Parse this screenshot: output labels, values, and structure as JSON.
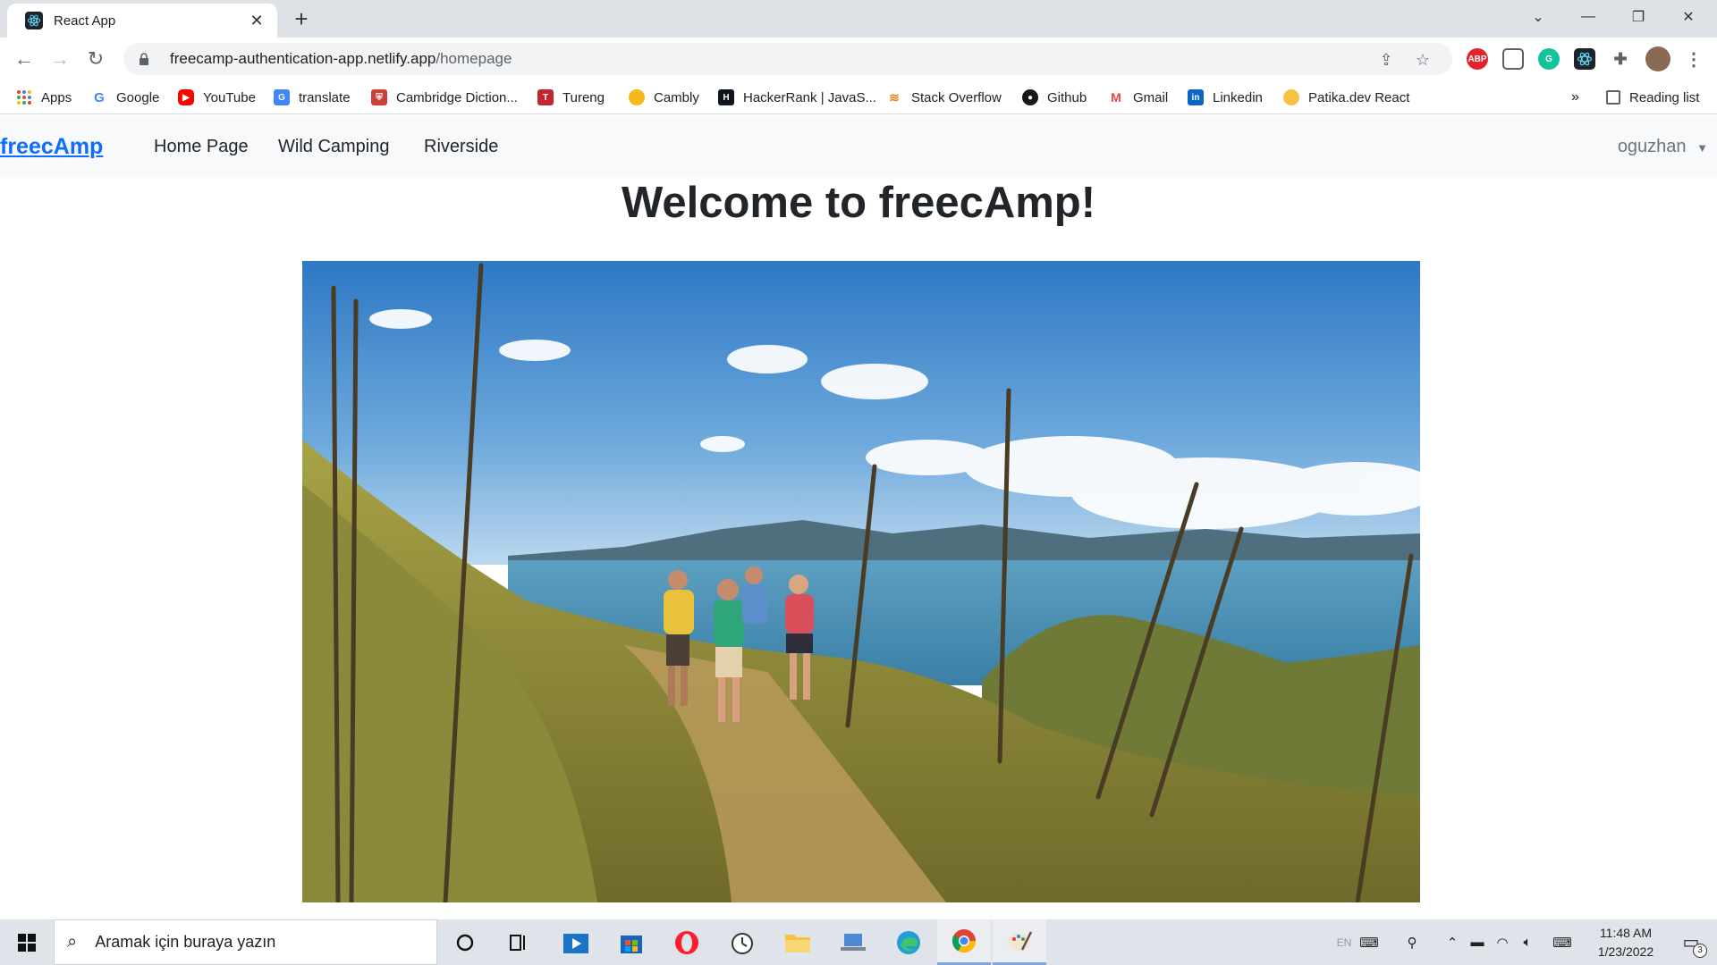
{
  "browser": {
    "tab": {
      "title": "React App"
    },
    "address": {
      "host": "freecamp-authentication-app.netlify.app",
      "path": "/homepage"
    },
    "bookmarks": [
      {
        "label": "Apps"
      },
      {
        "label": "Google"
      },
      {
        "label": "YouTube"
      },
      {
        "label": "translate"
      },
      {
        "label": "Cambridge Diction..."
      },
      {
        "label": "Tureng"
      },
      {
        "label": "Cambly"
      },
      {
        "label": "HackerRank | JavaS..."
      },
      {
        "label": "Stack Overflow"
      },
      {
        "label": "Github"
      },
      {
        "label": "Gmail"
      },
      {
        "label": "Linkedin"
      },
      {
        "label": "Patika.dev React"
      }
    ],
    "more_bookmarks": "»",
    "reading_list": "Reading list",
    "extension_labels": {
      "abp": "ABP"
    }
  },
  "page": {
    "navbar": {
      "brand": "freecAmp",
      "links": [
        "Home Page",
        "Wild Camping",
        "Riverside"
      ],
      "user": "oguzhan"
    },
    "title": "Welcome to freecAmp!"
  },
  "taskbar": {
    "search_placeholder": "Aramak için buraya yazın",
    "language": "EN",
    "time": "11:48 AM",
    "date": "1/23/2022",
    "notification_count": "3"
  },
  "colors": {
    "brand_link": "#0d6efd",
    "navbar_bg": "#f8f9fa",
    "tabstrip_bg": "#dee1e6",
    "taskbar_bg": "#dfe3ea"
  }
}
